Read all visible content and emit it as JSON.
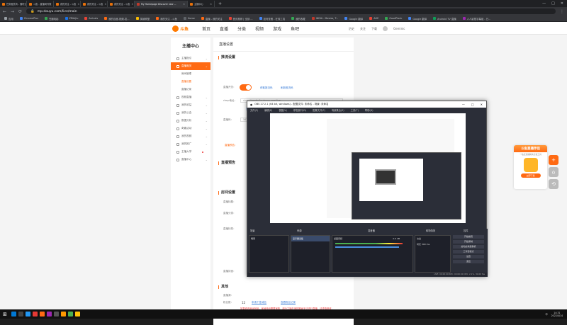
{
  "browser": {
    "tabs": [
      {
        "label": "任务租赁商 - 随时幻想和中华区",
        "color": "#e8710a"
      },
      {
        "label": "斗鱼 - 直播间列表",
        "color": "#e8710a"
      },
      {
        "label": "我的关注 - 斗鱼",
        "color": "#e8710a"
      },
      {
        "label": "我的关注 - 斗鱼",
        "color": "#e8710a"
      },
      {
        "label": "我的关注 - 斗鱼",
        "color": "#e8710a"
      },
      {
        "label": "My Homepage Discover new ...",
        "color": "#c0392b",
        "active": true
      },
      {
        "label": "主播中心",
        "color": "#e8710a"
      }
    ],
    "new_tab": "+",
    "window_controls": [
      "—",
      "□",
      "✕"
    ],
    "nav": [
      "←",
      "→",
      "⟳"
    ],
    "url": "mp.douyu.com/live/main",
    "bookmarks": [
      "应用",
      "ChromePlus",
      "豆瓣电影",
      "ZRibiJiu",
      "Arrivals",
      "我的百度-视频-发...",
      "英雄联盟",
      "我的关注 - 斗鱼",
      "Home",
      "直播 - 我的关注",
      "首页推荐 | 全部 ...",
      "如何查看 - 在线工具",
      "我的收藏",
      "INDIA - Movies, T...",
      "Google 翻译",
      "AGE",
      "GoodPlank",
      "Google 翻译",
      "Android TV 直播",
      "人人影视字幕组 - 日..."
    ]
  },
  "site": {
    "logo": "斗鱼",
    "nav": [
      "首页",
      "直播",
      "分类",
      "视频",
      "游戏",
      "鱼吧"
    ],
    "nav_right": [
      "历史",
      "关注",
      "下载",
      "Geminiс"
    ],
    "sidebar_title": "主播中心",
    "sidebar_items": [
      {
        "label": "主播指引",
        "chev": "⌄"
      },
      {
        "label": "直播相关",
        "chev": "⌄",
        "active": true
      },
      {
        "label": "房间管理",
        "sub": true
      },
      {
        "label": "直播设置",
        "sub": true,
        "on": true
      },
      {
        "label": "直播记录",
        "sub": true
      },
      {
        "label": "视频直播",
        "chev": "⌄"
      },
      {
        "label": "我的收益",
        "chev": "⌄"
      },
      {
        "label": "我的公会",
        "chev": "⌄"
      },
      {
        "label": "数据分析",
        "chev": "⌄"
      },
      {
        "label": "奇趣活动",
        "chev": "⌄"
      },
      {
        "label": "我的视频",
        "chev": "⌄"
      },
      {
        "label": "我的推广",
        "chev": "⌄"
      },
      {
        "label": "主播大学",
        "chev": "",
        "dot": true
      },
      {
        "label": "直播中心",
        "chev": "⌄"
      }
    ],
    "crumb": "直播设置",
    "sections": {
      "push": "推流设置",
      "notice": "直播预告",
      "room": "房间设置",
      "other": "其他"
    },
    "labels": {
      "live_toggle": "直播开关：",
      "rtmp": "rtmp地址：",
      "code": "直播码：",
      "notice": "直播预告：",
      "title": "直播标题：",
      "category": "直播分类：",
      "tags": "直播标签：",
      "cover": "直播封面：",
      "source": "直播源：",
      "url": "个性域名：",
      "count": "粉丝数："
    },
    "links": {
      "get_code": "获取推流码",
      "copy": "复制",
      "refresh": "刷新推流码",
      "apply": "申请个性域名",
      "view": "查看粉丝记录"
    },
    "values": {
      "rtmp": "rtmp://sendtc3a.douyu.com/live",
      "code": "5623...SGTR...&wsSecret=...&wsTime=...&wsSeek=...&auth=...",
      "url": "https://www.douyu.com/",
      "count": "12",
      "btn_select": "选择"
    },
    "notes": {
      "url_warn": "请勿修改，个性域名将用于您的账号。",
      "bottom": "如果修改房间号码，房间号码需要审核，部分主播在审核期间无法进行直播，请谨慎修改。"
    },
    "live_toggle": 1,
    "ad": {
      "head": "斗鱼直播伴侣",
      "sub": "一站式直播解决方案工具",
      "btn": "立即下载"
    },
    "float_icons": [
      "plus-icon",
      "home-icon",
      "refresh-icon"
    ],
    "float_colors": [
      "#ff6a13",
      "#bbbbbb",
      "#bbbbbb"
    ]
  },
  "obs": {
    "title": "OBS 27.2.1 (64 bit, windows) - 配置文件: 未命名 - 场景: 未命名",
    "menu": [
      "文件(F)",
      "编辑(E)",
      "视图(V)",
      "停靠窗口(D)",
      "配置文件(P)",
      "场景集合(S)",
      "工具(T)",
      "帮助(H)"
    ],
    "window_controls": [
      "—",
      "□",
      "✕"
    ],
    "docks": [
      "场景",
      "来源",
      "混音器",
      "转场特效",
      "控件"
    ],
    "scene_item": "场景",
    "source_item": "显示器采集",
    "mixer_item": "桌面音频",
    "mixer_db": "0.0 dB",
    "transition": "淡出",
    "transition_dur": "时长",
    "transition_val": "300 ms",
    "controls": [
      "开始推流",
      "开始录制",
      "启动虚拟摄像机",
      "工作室模式",
      "设置",
      "退出"
    ],
    "status": "LIVE: 00:00:00  REC: 00:00:00  CPU: 2.1%, 30.00 fps"
  },
  "taskbar": {
    "time": "14:31",
    "date": "2022/4/14",
    "lang": "中",
    "icons": [
      "#0078d4",
      "#444",
      "#2196f3",
      "#e53935",
      "#ff6a13",
      "#9c27b0",
      "#555",
      "#ff9800",
      "#4caf50",
      "#ffc107"
    ]
  }
}
